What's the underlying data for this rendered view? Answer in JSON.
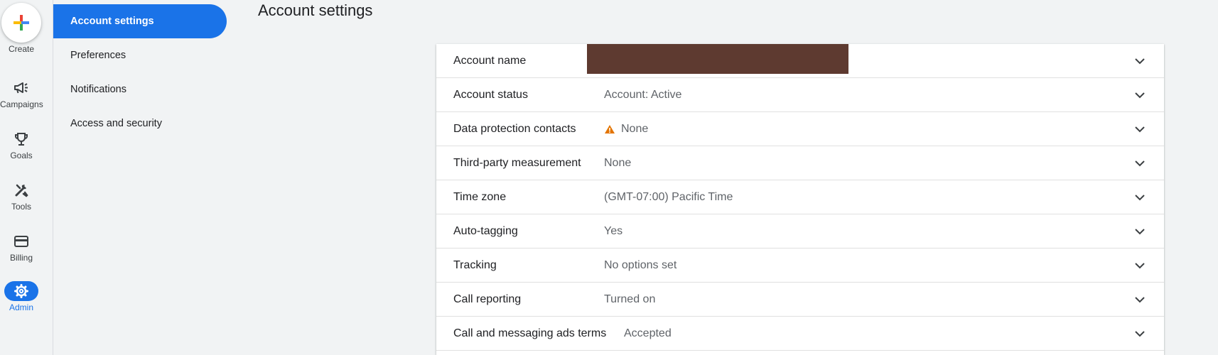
{
  "rail": {
    "items": [
      {
        "label": "Create",
        "icon": "plus-icon"
      },
      {
        "label": "Campaigns",
        "icon": "megaphone-icon"
      },
      {
        "label": "Goals",
        "icon": "trophy-icon"
      },
      {
        "label": "Tools",
        "icon": "tools-icon"
      },
      {
        "label": "Billing",
        "icon": "credit-card-icon"
      },
      {
        "label": "Admin",
        "icon": "gear-icon"
      }
    ],
    "active": "Admin"
  },
  "nav": {
    "items": [
      {
        "label": "Account settings",
        "active": true
      },
      {
        "label": "Preferences",
        "active": false
      },
      {
        "label": "Notifications",
        "active": false
      },
      {
        "label": "Access and security",
        "active": false
      }
    ]
  },
  "page": {
    "title": "Account settings"
  },
  "settings": {
    "rows": [
      {
        "label": "Account name",
        "value": ""
      },
      {
        "label": "Account status",
        "value": "Account: Active"
      },
      {
        "label": "Data protection contacts",
        "value": "None",
        "icon": "warning-icon"
      },
      {
        "label": "Third-party measurement",
        "value": "None"
      },
      {
        "label": "Time zone",
        "value": "(GMT-07:00) Pacific Time"
      },
      {
        "label": "Auto-tagging",
        "value": "Yes"
      },
      {
        "label": "Tracking",
        "value": "No options set"
      },
      {
        "label": "Call reporting",
        "value": "Turned on"
      },
      {
        "label": "Call and messaging ads terms",
        "value": "Accepted"
      }
    ]
  },
  "colors": {
    "accent": "#1a73e8",
    "warning": "#e37400",
    "redaction": "#5e3a30"
  }
}
